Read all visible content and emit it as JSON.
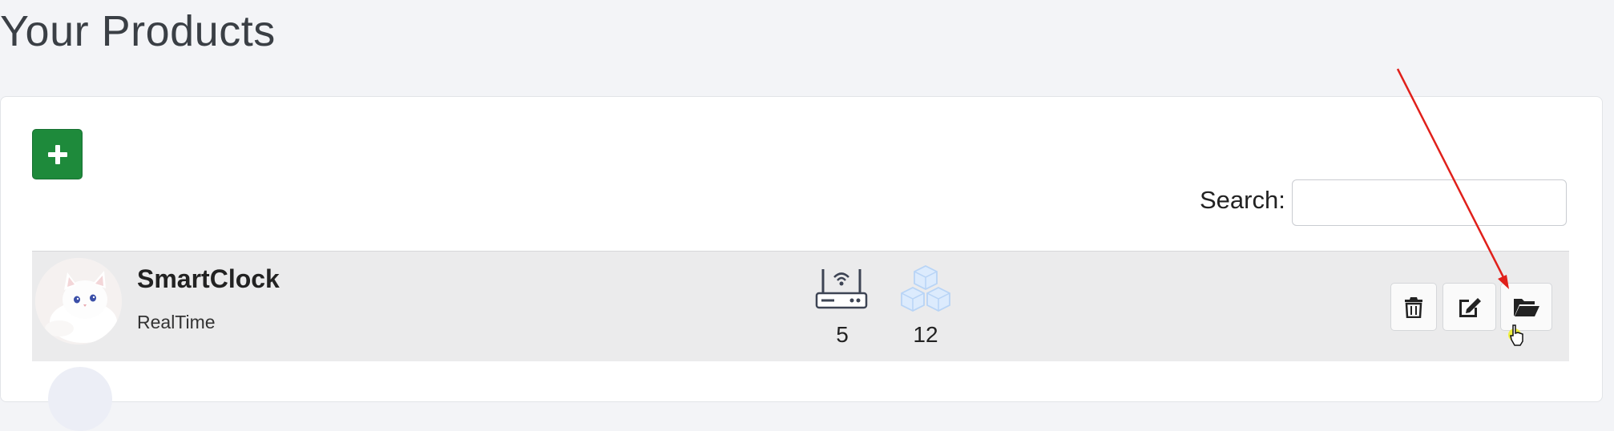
{
  "page": {
    "title": "Your Products"
  },
  "toolbar": {
    "add_icon": "plus-icon"
  },
  "search": {
    "label": "Search:",
    "value": "",
    "placeholder": ""
  },
  "products": [
    {
      "name": "SmartClock",
      "subtitle": "RealTime",
      "avatar": "kitten-photo",
      "devices": {
        "icon": "router-icon",
        "count": "5"
      },
      "modules": {
        "icon": "cubes-icon",
        "count": "12"
      },
      "actions": [
        {
          "name": "delete",
          "icon": "trash-icon"
        },
        {
          "name": "edit",
          "icon": "edit-icon"
        },
        {
          "name": "open",
          "icon": "folder-open-icon"
        }
      ]
    }
  ],
  "colors": {
    "add_button": "#1e8a3b",
    "row_background": "#ebebec",
    "annotation_arrow": "#e0201b",
    "cubes_icon": "#cfe3fb"
  }
}
